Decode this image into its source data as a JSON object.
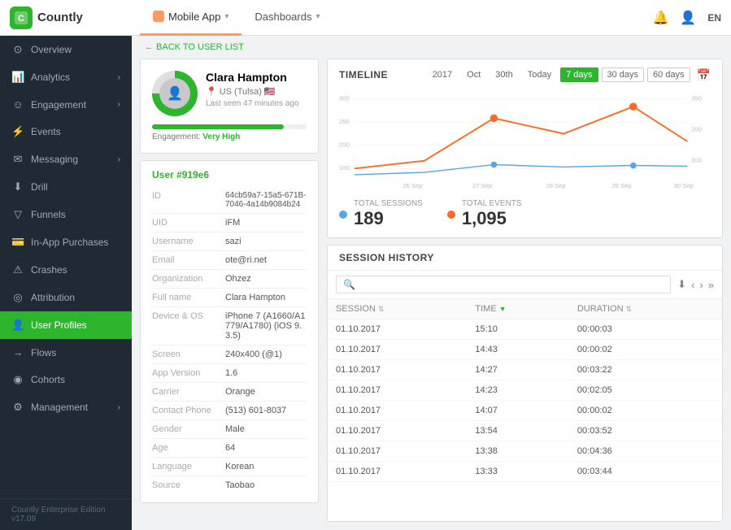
{
  "app": {
    "logo_text": "Countly",
    "logo_abbr": "C"
  },
  "topnav": {
    "tabs": [
      {
        "id": "mobile-app",
        "label": "Mobile App",
        "active": true
      },
      {
        "id": "dashboards",
        "label": "Dashboards",
        "active": false
      }
    ],
    "lang": "EN"
  },
  "sidebar": {
    "items": [
      {
        "id": "overview",
        "label": "Overview",
        "icon": "⊙",
        "has_arrow": false
      },
      {
        "id": "analytics",
        "label": "Analytics",
        "icon": "📈",
        "has_arrow": true
      },
      {
        "id": "engagement",
        "label": "Engagement",
        "icon": "☺",
        "has_arrow": true
      },
      {
        "id": "events",
        "label": "Events",
        "icon": "⚡",
        "has_arrow": false
      },
      {
        "id": "messaging",
        "label": "Messaging",
        "icon": "✉",
        "has_arrow": true
      },
      {
        "id": "drill",
        "label": "Drill",
        "icon": "⬇",
        "has_arrow": false
      },
      {
        "id": "funnels",
        "label": "Funnels",
        "icon": "▽",
        "has_arrow": false
      },
      {
        "id": "in-app-purchases",
        "label": "In-App Purchases",
        "icon": "💳",
        "has_arrow": false
      },
      {
        "id": "crashes",
        "label": "Crashes",
        "icon": "⚠",
        "has_arrow": false
      },
      {
        "id": "attribution",
        "label": "Attribution",
        "icon": "◎",
        "has_arrow": false
      },
      {
        "id": "user-profiles",
        "label": "User Profiles",
        "icon": "👤",
        "has_arrow": false,
        "active": true
      },
      {
        "id": "flows",
        "label": "Flows",
        "icon": "→",
        "has_arrow": false
      },
      {
        "id": "cohorts",
        "label": "Cohorts",
        "icon": "◉",
        "has_arrow": false
      },
      {
        "id": "management",
        "label": "Management",
        "icon": "⚙",
        "has_arrow": true
      }
    ],
    "footer": "Countly Enterprise Edition v17.09"
  },
  "breadcrumb": {
    "arrow": "← BACK TO USER LIST"
  },
  "profile": {
    "name": "Clara Hampton",
    "location": "US (Tulsa)",
    "last_seen": "Last seen 47 minutes ago",
    "engagement_level": "Very High",
    "user_id_title": "User #919e6"
  },
  "user_fields": [
    {
      "label": "ID",
      "value": "64cb59a7-15a5-671B-7046-4a14b9084b24"
    },
    {
      "label": "UID",
      "value": "iFM"
    },
    {
      "label": "Username",
      "value": "sazi"
    },
    {
      "label": "Email",
      "value": "ote@ri.net"
    },
    {
      "label": "Organization",
      "value": "Ohzez"
    },
    {
      "label": "Full name",
      "value": "Clara Hampton"
    },
    {
      "label": "Device & OS",
      "value": "iPhone 7 (A1660/A1779/A1780) (iOS 9.3.5)"
    },
    {
      "label": "Screen",
      "value": "240x400 (@1)"
    },
    {
      "label": "App Version",
      "value": "1.6"
    },
    {
      "label": "Carrier",
      "value": "Orange"
    },
    {
      "label": "Contact Phone",
      "value": "(513) 601-8037"
    },
    {
      "label": "Gender",
      "value": "Male"
    },
    {
      "label": "Age",
      "value": "64"
    },
    {
      "label": "Language",
      "value": "Korean"
    },
    {
      "label": "Source",
      "value": "Taobao"
    }
  ],
  "timeline": {
    "title": "TIMELINE",
    "filters": [
      "2017",
      "Oct",
      "30th",
      "Today",
      "7 days",
      "30 days",
      "60 days"
    ],
    "active_filter": "7 days",
    "x_labels": [
      "26 Sep",
      "27 Sep",
      "28 Sep",
      "29 Sep",
      "30 Sep"
    ],
    "total_sessions": "189",
    "total_events": "1,095",
    "sessions_label": "TOTAL SESSIONS",
    "events_label": "TOTAL EVENTS",
    "sessions_color": "#5ba4e5",
    "events_color": "#f96b26"
  },
  "session_history": {
    "title": "SESSION HISTORY",
    "search_placeholder": "Search...",
    "columns": [
      "SESSION",
      "TIME",
      "DURATION"
    ],
    "rows": [
      {
        "session": "01.10.2017",
        "time": "15:10",
        "duration": "00:00:03"
      },
      {
        "session": "01.10.2017",
        "time": "14:43",
        "duration": "00:00:02"
      },
      {
        "session": "01.10.2017",
        "time": "14:27",
        "duration": "00:03:22"
      },
      {
        "session": "01.10.2017",
        "time": "14:23",
        "duration": "00:02:05"
      },
      {
        "session": "01.10.2017",
        "time": "14:07",
        "duration": "00:00:02"
      },
      {
        "session": "01.10.2017",
        "time": "13:54",
        "duration": "00:03:52"
      },
      {
        "session": "01.10.2017",
        "time": "13:38",
        "duration": "00:04:36"
      },
      {
        "session": "01.10.2017",
        "time": "13:33",
        "duration": "00:03:44"
      }
    ]
  }
}
